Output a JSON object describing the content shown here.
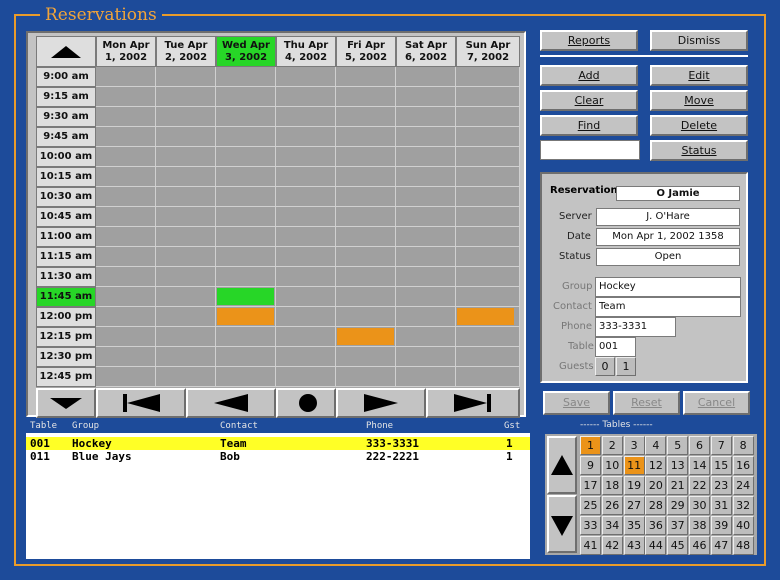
{
  "window": {
    "title": "Reservations"
  },
  "calendar": {
    "days": [
      {
        "line1": "Mon Apr",
        "line2": "1, 2002",
        "selected": false
      },
      {
        "line1": "Tue Apr",
        "line2": "2, 2002",
        "selected": false
      },
      {
        "line1": "Wed Apr",
        "line2": "3, 2002",
        "selected": true
      },
      {
        "line1": "Thu Apr",
        "line2": "4, 2002",
        "selected": false
      },
      {
        "line1": "Fri Apr",
        "line2": "5, 2002",
        "selected": false
      },
      {
        "line1": "Sat Apr",
        "line2": "6, 2002",
        "selected": false
      },
      {
        "line1": "Sun Apr",
        "line2": "7, 2002",
        "selected": false
      }
    ],
    "times": [
      "9:00 am",
      "9:15 am",
      "9:30 am",
      "9:45 am",
      "10:00 am",
      "10:15 am",
      "10:30 am",
      "10:45 am",
      "11:00 am",
      "11:15 am",
      "11:30 am",
      "11:45 am",
      "12:00 pm",
      "12:15 pm",
      "12:30 pm",
      "12:45 pm"
    ],
    "selected_time": "11:45 am",
    "scroll_up_icon": "triangle-up-icon",
    "scroll_down_icon": "triangle-down-icon",
    "nav_icons": [
      "skip-first-icon",
      "prev-icon",
      "today-dot-icon",
      "next-icon",
      "skip-last-icon"
    ],
    "bookings": [
      {
        "day_index": 2,
        "time": "11:45 am",
        "color": "#27d627"
      },
      {
        "day_index": 2,
        "time": "12:00 pm",
        "color": "#eb9319"
      },
      {
        "day_index": 6,
        "time": "12:00 pm",
        "color": "#eb9319"
      },
      {
        "day_index": 4,
        "time": "12:15 pm",
        "color": "#eb9319"
      }
    ]
  },
  "buttons": {
    "reports": "Reports",
    "dismiss": "Dismiss",
    "add": "Add",
    "edit": "Edit",
    "clear": "Clear",
    "move": "Move",
    "find": "Find",
    "delete": "Delete",
    "status": "Status",
    "save": "Save",
    "reset": "Reset",
    "cancel": "Cancel"
  },
  "detail": {
    "reservation_label": "Reservation",
    "reservation_value": "O Jamie",
    "server_label": "Server",
    "server_value": "J. O'Hare",
    "date_label": "Date",
    "date_value": "Mon Apr  1, 2002 1358",
    "status_label": "Status",
    "status_value": "Open",
    "group_label": "Group",
    "group_value": "Hockey",
    "contact_label": "Contact",
    "contact_value": "Team",
    "phone_label": "Phone",
    "phone_value": "333-3331",
    "table_label": "Table",
    "table_value": "001",
    "guests_label": "Guests",
    "guests_a": "0",
    "guests_b": "1"
  },
  "list": {
    "headers": {
      "table": "Table",
      "group": "Group",
      "contact": "Contact",
      "phone": "Phone",
      "gst": "Gst"
    },
    "rows": [
      {
        "table": "001",
        "group": "Hockey",
        "contact": "Team",
        "phone": "333-3331",
        "gst": "1",
        "selected": true
      },
      {
        "table": "011",
        "group": "Blue Jays",
        "contact": "Bob",
        "phone": "222-2221",
        "gst": "1",
        "selected": false
      }
    ]
  },
  "tables": {
    "header": "------ Tables ------",
    "numbers": [
      "1",
      "2",
      "3",
      "4",
      "5",
      "6",
      "7",
      "8",
      "9",
      "10",
      "11",
      "12",
      "13",
      "14",
      "15",
      "16",
      "17",
      "18",
      "19",
      "20",
      "21",
      "22",
      "23",
      "24",
      "25",
      "26",
      "27",
      "28",
      "29",
      "30",
      "31",
      "32",
      "33",
      "34",
      "35",
      "36",
      "37",
      "38",
      "39",
      "40",
      "41",
      "42",
      "43",
      "44",
      "45",
      "46",
      "47",
      "48"
    ],
    "active": [
      "1",
      "11"
    ],
    "active_color": "#eb9319"
  }
}
